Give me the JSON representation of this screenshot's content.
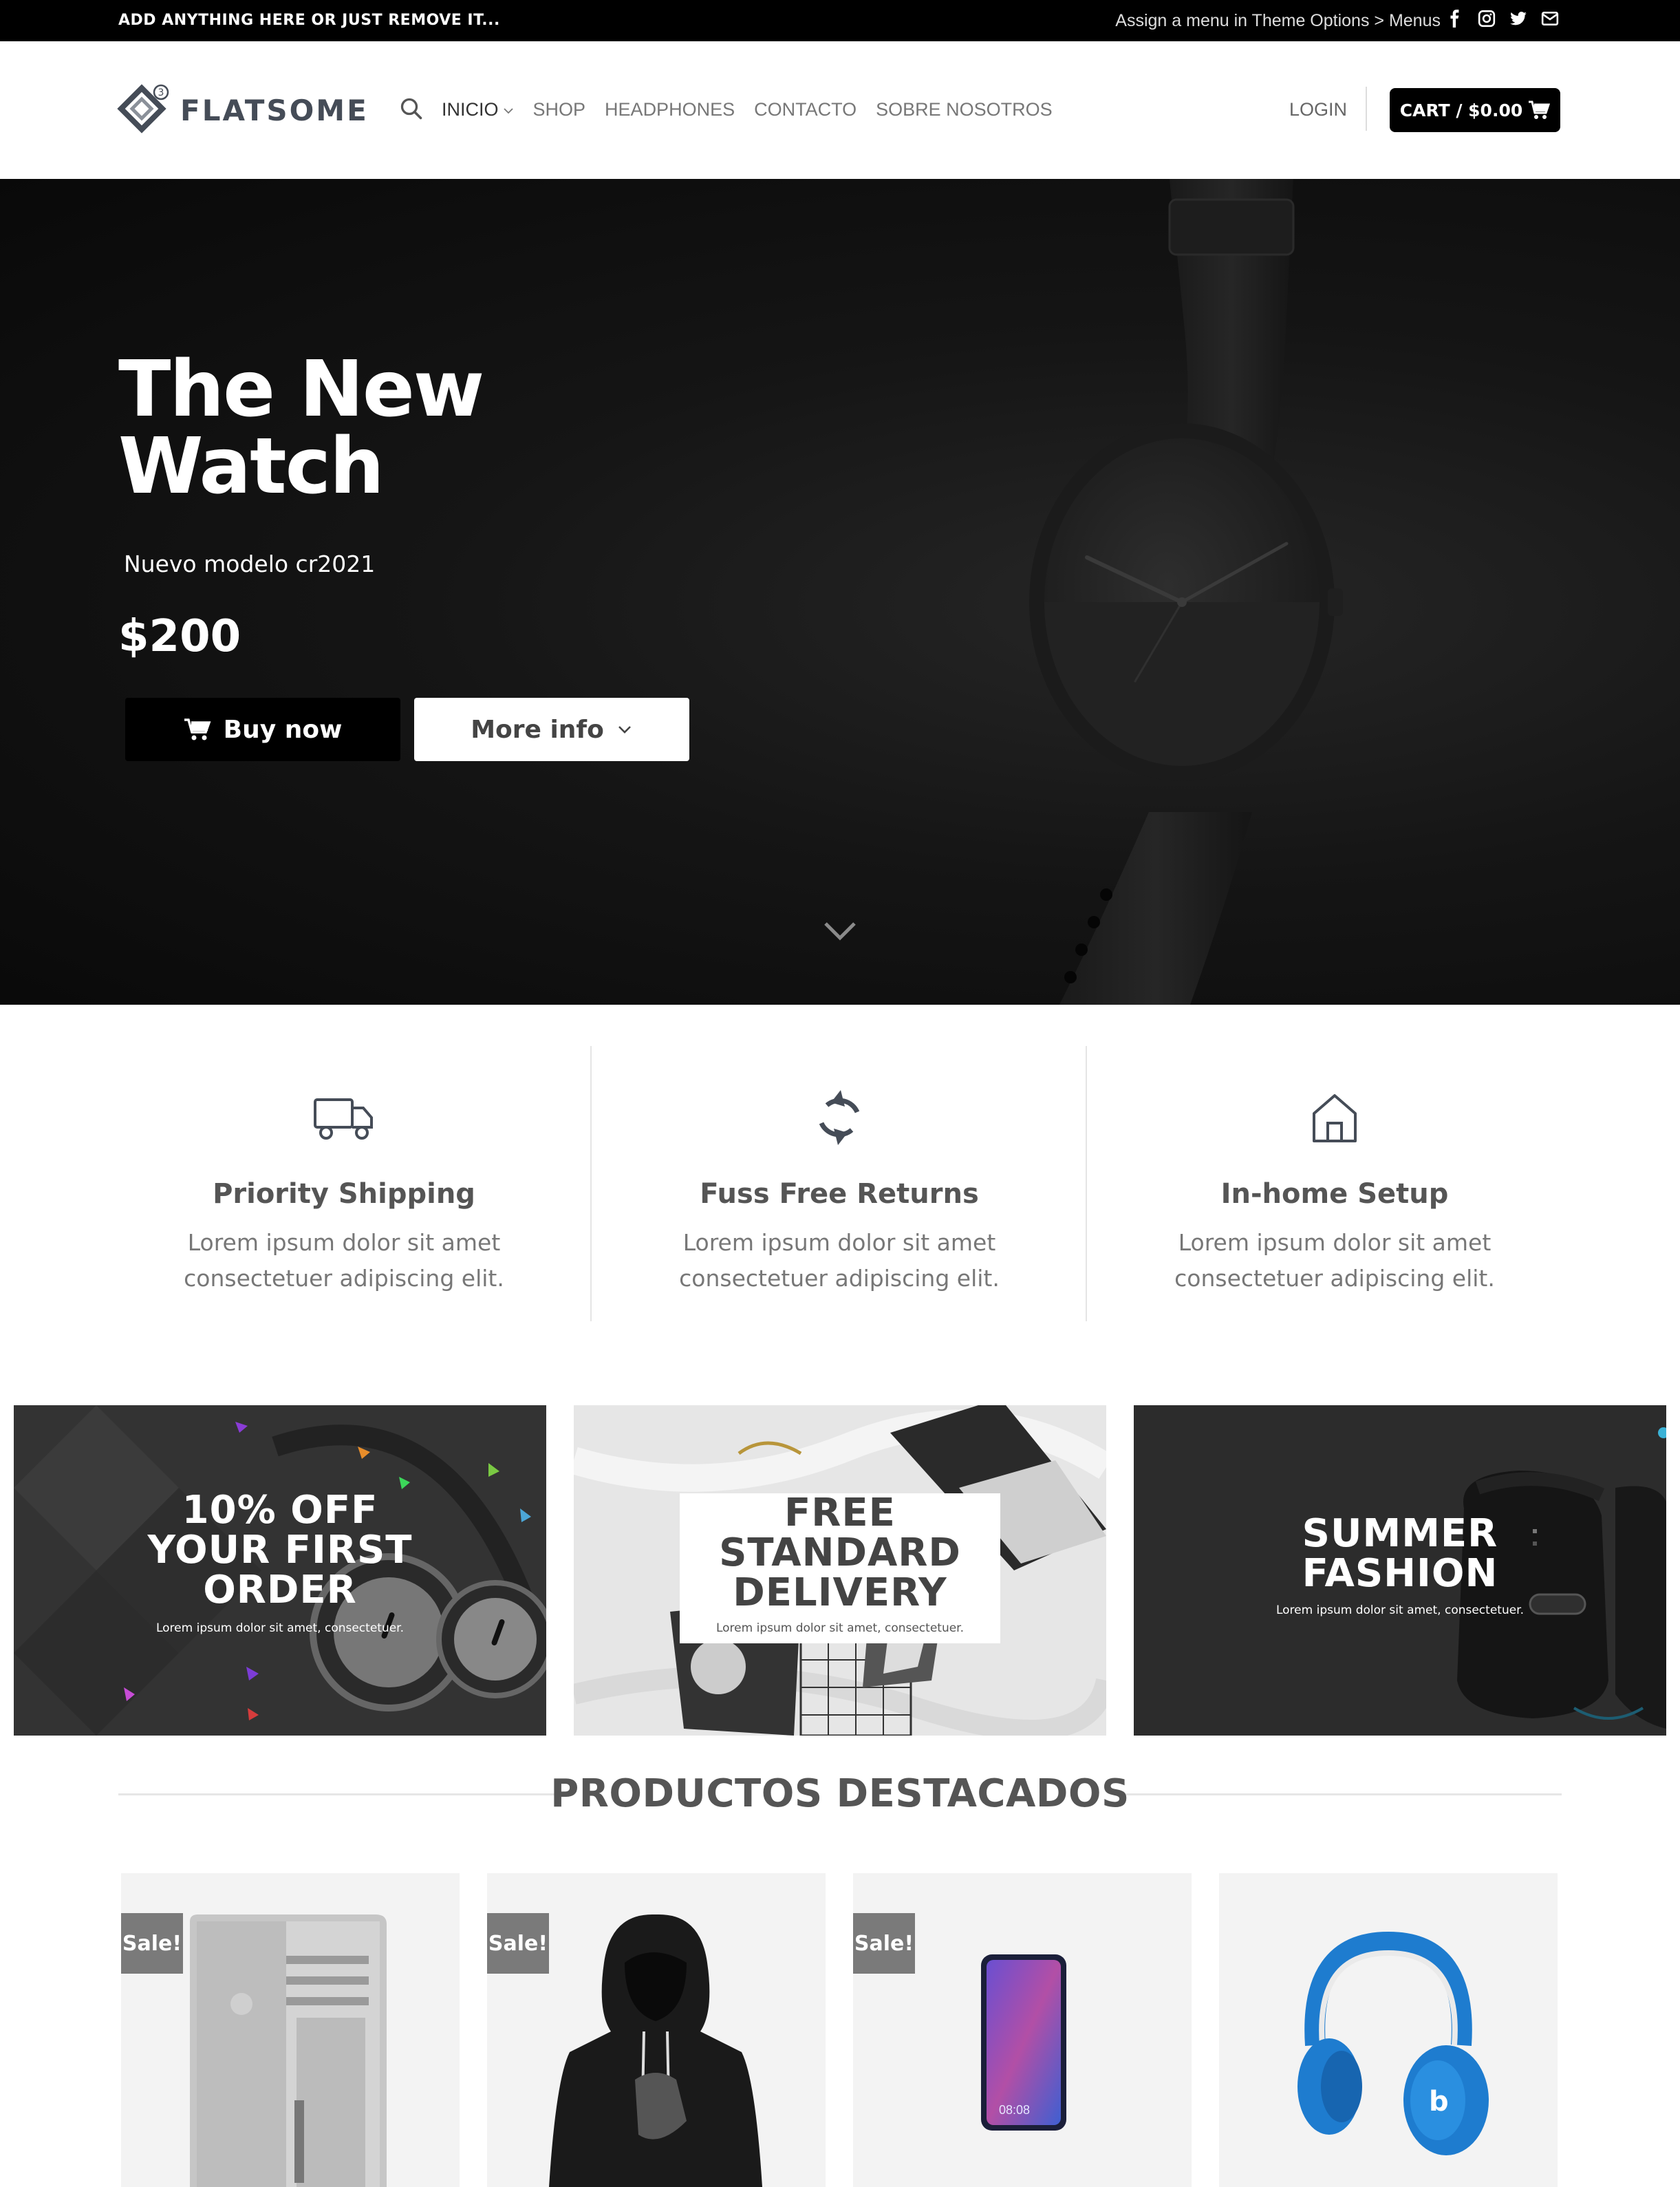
{
  "topbar": {
    "left_text": "ADD ANYTHING HERE OR JUST REMOVE IT...",
    "right_text": "Assign a menu in Theme Options > Menus",
    "social_icons": [
      "facebook-icon",
      "instagram-icon",
      "twitter-icon",
      "email-icon"
    ]
  },
  "header": {
    "logo_text": "FLATSOME",
    "logo_badge": "3",
    "nav": [
      "INICIO",
      "SHOP",
      "HEADPHONES",
      "CONTACTO",
      "SOBRE NOSOTROS"
    ],
    "login": "LOGIN",
    "cart": "CART / $0.00"
  },
  "hero": {
    "title_line1": "The New",
    "title_line2": "Watch",
    "subtitle": "Nuevo modelo cr2021",
    "price": "$200",
    "buy_label": "Buy now",
    "more_label": "More info"
  },
  "features": [
    {
      "icon": "truck-icon",
      "title": "Priority Shipping",
      "desc1": "Lorem ipsum dolor sit amet",
      "desc2": "consectetuer adipiscing elit."
    },
    {
      "icon": "refresh-icon",
      "title": "Fuss Free Returns",
      "desc1": "Lorem ipsum dolor sit amet",
      "desc2": "consectetuer adipiscing elit."
    },
    {
      "icon": "home-icon",
      "title": "In-home Setup",
      "desc1": "Lorem ipsum dolor sit amet",
      "desc2": "consectetuer adipiscing elit."
    }
  ],
  "promos": [
    {
      "line1": "10% OFF",
      "line2": "YOUR FIRST",
      "line3": "ORDER",
      "sub": "Lorem ipsum dolor sit amet, consectetuer."
    },
    {
      "line1": "FREE",
      "line2": "STANDARD",
      "line3": "DELIVERY",
      "sub": "Lorem ipsum dolor sit amet, consectetuer."
    },
    {
      "line1": "SUMMER",
      "line2": "FASHION",
      "sub": "Lorem ipsum dolor sit amet, consectetuer."
    }
  ],
  "featured": {
    "title": "PRODUCTOS DESTACADOS",
    "products": [
      {
        "badge": "Sale!",
        "image": "tower-computer"
      },
      {
        "badge": "Sale!",
        "image": "black-hoodie"
      },
      {
        "badge": "Sale!",
        "image": "smartphone",
        "screen_time": "08:08"
      },
      {
        "badge": "",
        "image": "blue-headphones"
      }
    ]
  },
  "colors": {
    "topbar_bg": "#000000",
    "hero_bg": "#111111",
    "text_dark": "#555555",
    "sale_badge": "#7a7a7a",
    "headphone_blue": "#1e7ccf"
  }
}
